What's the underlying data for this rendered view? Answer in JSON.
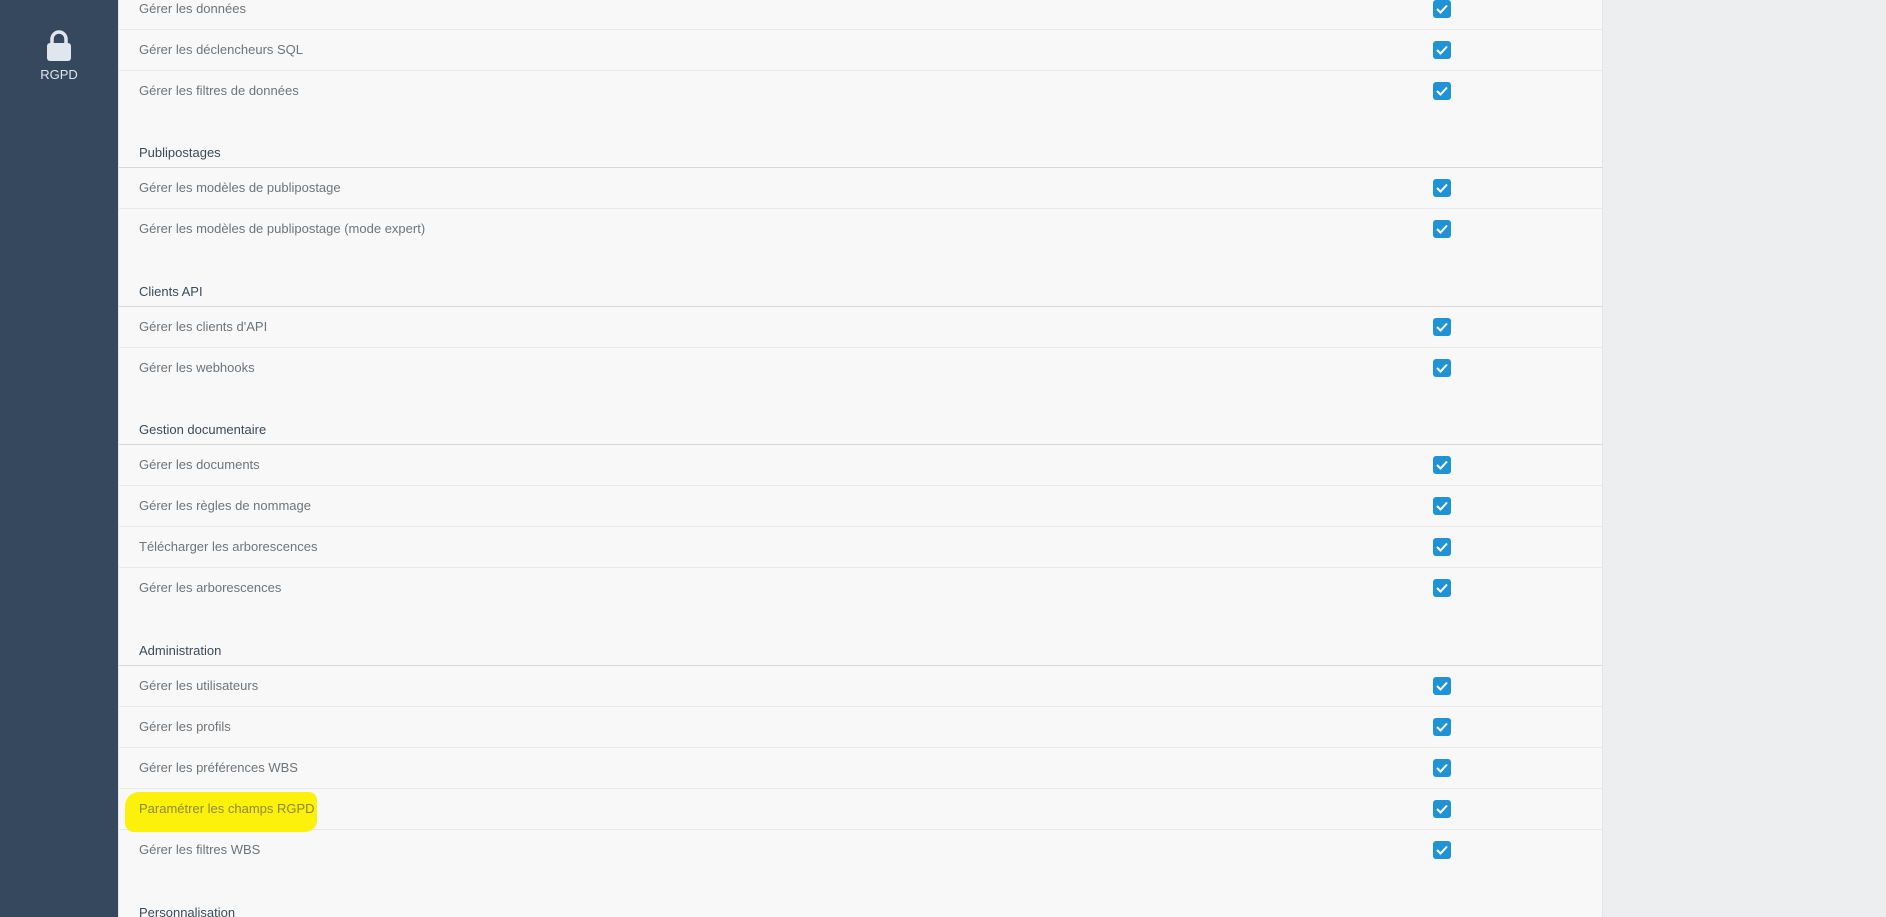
{
  "sidebar": {
    "items": [
      {
        "icon": "lock-icon",
        "label": "RGPD"
      }
    ]
  },
  "colors": {
    "sidebar_bg": "#35485d",
    "checkbox": "#1f93d6",
    "highlight": "#fbf10a"
  },
  "permissions": {
    "top_rows": [
      {
        "label": "Gérer les données",
        "checked": true
      },
      {
        "label": "Gérer les déclencheurs SQL",
        "checked": true
      },
      {
        "label": "Gérer les filtres de données",
        "checked": true
      }
    ],
    "sections": [
      {
        "title": "Publipostages",
        "rows": [
          {
            "label": "Gérer les modèles de publipostage",
            "checked": true
          },
          {
            "label": "Gérer les modèles de publipostage (mode expert)",
            "checked": true
          }
        ]
      },
      {
        "title": "Clients API",
        "rows": [
          {
            "label": "Gérer les clients d'API",
            "checked": true
          },
          {
            "label": "Gérer les webhooks",
            "checked": true
          }
        ]
      },
      {
        "title": "Gestion documentaire",
        "rows": [
          {
            "label": "Gérer les documents",
            "checked": true
          },
          {
            "label": "Gérer les règles de nommage",
            "checked": true
          },
          {
            "label": "Télécharger les arborescences",
            "checked": true
          },
          {
            "label": "Gérer les arborescences",
            "checked": true
          }
        ]
      },
      {
        "title": "Administration",
        "rows": [
          {
            "label": "Gérer les utilisateurs",
            "checked": true
          },
          {
            "label": "Gérer les profils",
            "checked": true
          },
          {
            "label": "Gérer les préférences WBS",
            "checked": true
          },
          {
            "label": "Paramétrer les champs RGPD",
            "checked": true,
            "highlighted": true
          },
          {
            "label": "Gérer les filtres WBS",
            "checked": true
          }
        ]
      },
      {
        "title": "Personnalisation",
        "rows": []
      }
    ]
  }
}
